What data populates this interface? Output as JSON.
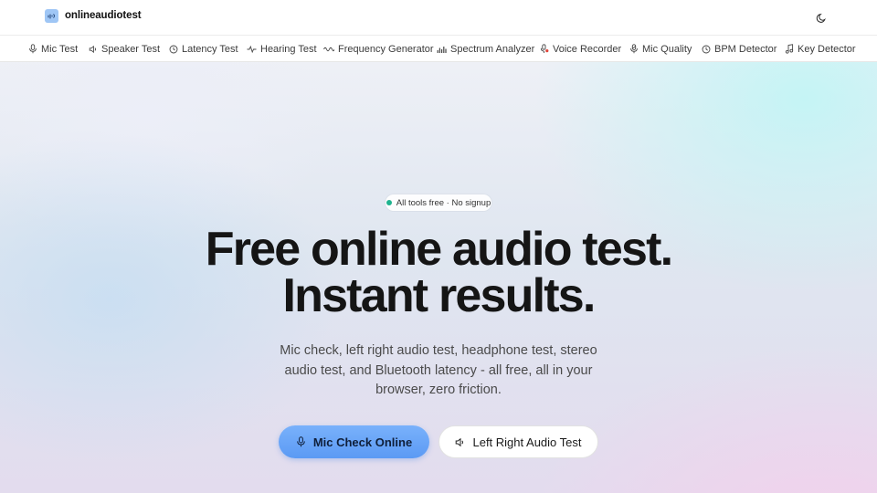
{
  "header": {
    "brand_name": "onlineaudiotest",
    "brand_icon": "sound-wave-icon",
    "theme_toggle_icon": "moon-icon"
  },
  "nav": {
    "items": [
      {
        "label": "Mic Test",
        "icon": "microphone-icon"
      },
      {
        "label": "Speaker Test",
        "icon": "speaker-icon"
      },
      {
        "label": "Latency Test",
        "icon": "clock-icon"
      },
      {
        "label": "Hearing Test",
        "icon": "pulse-icon"
      },
      {
        "label": "Frequency Generator",
        "icon": "sine-wave-icon"
      },
      {
        "label": "Spectrum Analyzer",
        "icon": "bar-chart-icon"
      },
      {
        "label": "Voice Recorder",
        "icon": "record-icon"
      },
      {
        "label": "Mic Quality",
        "icon": "mic-check-icon"
      },
      {
        "label": "BPM Detector",
        "icon": "timer-icon"
      },
      {
        "label": "Key Detector",
        "icon": "music-note-icon"
      }
    ]
  },
  "hero": {
    "badge": "All tools free · No signup",
    "headline_line1": "Free online audio test.",
    "headline_line2": "Instant results.",
    "subtitle": "Mic check, left right audio test, headphone test, stereo audio test, and Bluetooth latency - all free, all in your browser, zero friction.",
    "primary_button": "Mic Check Online",
    "secondary_button": "Left Right Audio Test"
  },
  "colors": {
    "primary_button": "#6aa6f8",
    "badge_dot": "#1fb38f",
    "text": "#151515"
  }
}
